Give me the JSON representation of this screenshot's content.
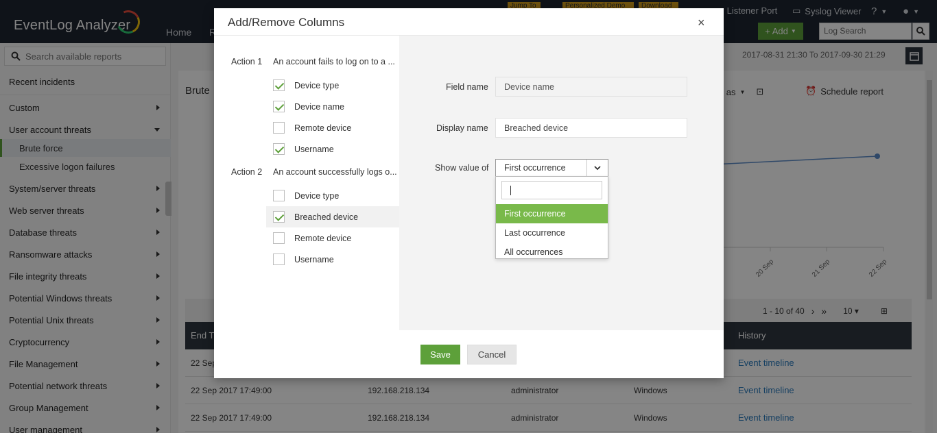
{
  "app": {
    "brand": "EventLog Analyzer",
    "nav": [
      "Home",
      "R"
    ],
    "chips": [
      "Jump To",
      "Personalized Demo",
      "Download"
    ],
    "listener_port": "Listener Port",
    "syslog_viewer": "Syslog Viewer",
    "help": "?",
    "add_label": "+ Add",
    "log_search_placeholder": "Log Search"
  },
  "sidebar": {
    "search_placeholder": "Search available reports",
    "recent": "Recent incidents",
    "items": [
      {
        "label": "Custom"
      },
      {
        "label": "User account threats"
      },
      {
        "label": "Brute force"
      },
      {
        "label": "Excessive logon failures"
      },
      {
        "label": "System/server threats"
      },
      {
        "label": "Web server threats"
      },
      {
        "label": "Database threats"
      },
      {
        "label": "Ransomware attacks"
      },
      {
        "label": "File integrity threats"
      },
      {
        "label": "Potential Windows threats"
      },
      {
        "label": "Potential Unix threats"
      },
      {
        "label": "Cryptocurrency"
      },
      {
        "label": "File Management"
      },
      {
        "label": "Potential network threats"
      },
      {
        "label": "Group Management"
      },
      {
        "label": "User management"
      }
    ]
  },
  "main": {
    "date_range": "2017-08-31 21:30 To 2017-09-30 21:29",
    "title": "Brute",
    "export_label": "ort as",
    "schedule_label": "Schedule report",
    "chart_ticks": [
      "20 Sep",
      "21 Sep",
      "22 Sep"
    ],
    "pager_text": "1 - 10 of 40",
    "page_size": "10",
    "columns": [
      "End Ti",
      "History"
    ],
    "rows": [
      {
        "time": "22 Sep",
        "ip": "",
        "user": "",
        "os": "",
        "history": "Event timeline"
      },
      {
        "time": "22 Sep 2017 17:49:00",
        "ip": "192.168.218.134",
        "user": "administrator",
        "os": "Windows",
        "history": "Event timeline"
      },
      {
        "time": "22 Sep 2017 17:49:00",
        "ip": "192.168.218.134",
        "user": "administrator",
        "os": "Windows",
        "history": "Event timeline"
      }
    ]
  },
  "modal": {
    "title": "Add/Remove Columns",
    "close": "×",
    "action1": {
      "label": "Action 1",
      "desc": "An account fails to log on to a ...",
      "fields": [
        {
          "label": "Device type",
          "checked": true
        },
        {
          "label": "Device name",
          "checked": true
        },
        {
          "label": "Remote device",
          "checked": false
        },
        {
          "label": "Username",
          "checked": true
        }
      ]
    },
    "action2": {
      "label": "Action 2",
      "desc": "An account successfully logs o...",
      "fields": [
        {
          "label": "Device type",
          "checked": false
        },
        {
          "label": "Breached device",
          "checked": true
        },
        {
          "label": "Remote device",
          "checked": false
        },
        {
          "label": "Username",
          "checked": false
        }
      ]
    },
    "field_name_label": "Field name",
    "field_name_value": "Device name",
    "display_name_label": "Display name",
    "display_name_value": "Breached device",
    "show_value_label": "Show value of",
    "show_value_selected": "First occurrence",
    "options": [
      "First occurrence",
      "Last occurrence",
      "All occurrences"
    ],
    "save": "Save",
    "cancel": "Cancel"
  },
  "colors": {
    "accent": "#5da03a",
    "option_selected": "#79b94a",
    "header_bg": "#1e2530",
    "link": "#2b7bbd"
  }
}
